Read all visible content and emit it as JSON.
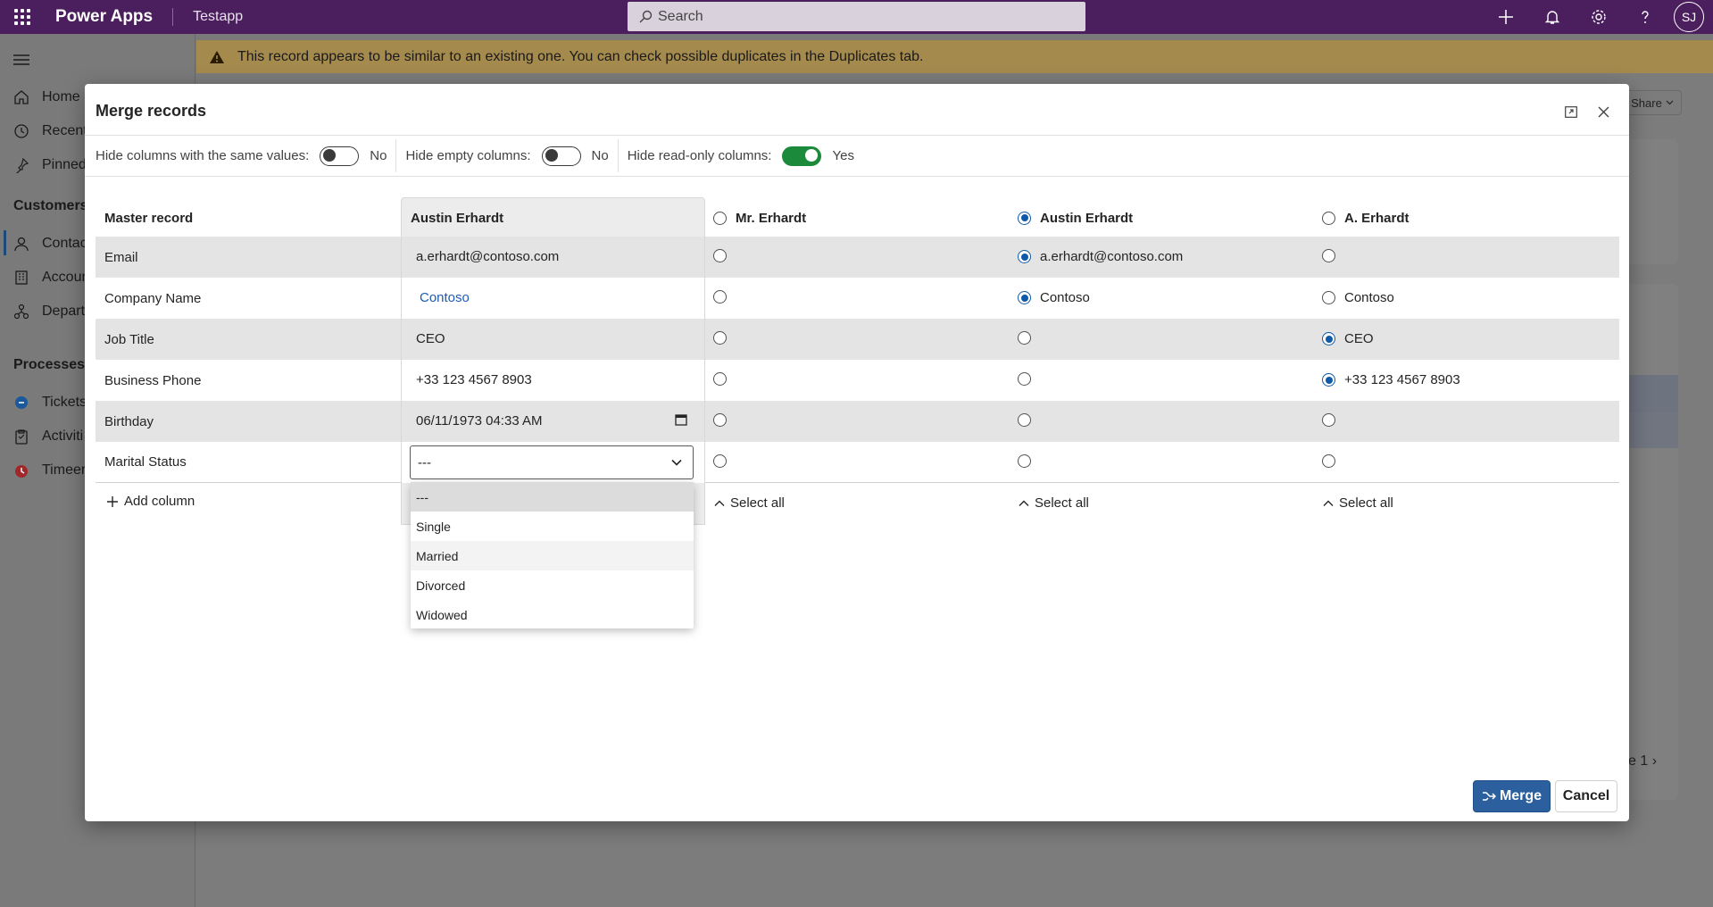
{
  "topbar": {
    "app_name": "Power Apps",
    "env_name": "Testapp",
    "search_placeholder": "Search",
    "avatar_initials": "SJ"
  },
  "nav": {
    "items": [
      {
        "label": "Home",
        "icon": "home-icon"
      },
      {
        "label": "Recent",
        "icon": "clock-icon"
      },
      {
        "label": "Pinned",
        "icon": "pin-icon"
      }
    ],
    "section_customers": "Customers",
    "customers_items": [
      {
        "label": "Contac",
        "icon": "person-icon"
      },
      {
        "label": "Accoun",
        "icon": "building-icon"
      },
      {
        "label": "Depart",
        "icon": "org-icon"
      }
    ],
    "section_processes": "Processes",
    "processes_items": [
      {
        "label": "Tickets",
        "icon": "ticket-icon"
      },
      {
        "label": "Activiti",
        "icon": "clipboard-icon"
      },
      {
        "label": "Timeer",
        "icon": "timer-icon"
      }
    ]
  },
  "banner": {
    "text": "This record appears to be similar to an existing one. You can check possible duplicates in the Duplicates tab."
  },
  "background": {
    "share_label": "Share",
    "page_label": "e 1"
  },
  "modal": {
    "title": "Merge records",
    "options": {
      "hide_same_label": "Hide columns with the same values:",
      "hide_same_value": "No",
      "hide_same_on": false,
      "hide_empty_label": "Hide empty columns:",
      "hide_empty_value": "No",
      "hide_empty_on": false,
      "hide_readonly_label": "Hide read-only columns:",
      "hide_readonly_value": "Yes",
      "hide_readonly_on": true
    },
    "header": {
      "label": "Master record",
      "master": "Austin Erhardt",
      "col_a": "Mr. Erhardt",
      "col_b": "Austin Erhardt",
      "col_c": "A. Erhardt",
      "selected_column": "col_b"
    },
    "rows": [
      {
        "label": "Email",
        "master": "a.erhardt@contoso.com",
        "a": "",
        "b": "a.erhardt@contoso.com",
        "c": "",
        "selected": "b"
      },
      {
        "label": "Company Name",
        "master": "Contoso",
        "a": "",
        "b": "Contoso",
        "c": "Contoso",
        "selected": "b"
      },
      {
        "label": "Job Title",
        "master": "CEO",
        "a": "",
        "b": "",
        "c": "CEO",
        "selected": "c"
      },
      {
        "label": "Business Phone",
        "master": "+33 123 4567 8903",
        "a": "",
        "b": "",
        "c": "+33 123 4567 8903",
        "selected": "c"
      },
      {
        "label": "Birthday",
        "master": "06/11/1973 04:33 AM",
        "a": "",
        "b": "",
        "c": "",
        "selected": ""
      },
      {
        "label": "Marital Status",
        "master": "---",
        "a": "",
        "b": "",
        "c": "",
        "selected": ""
      }
    ],
    "marital_options": [
      "---",
      "Single",
      "Married",
      "Divorced",
      "Widowed"
    ],
    "add_column_label": "Add column",
    "select_all_label": "Select all",
    "merge_label": "Merge",
    "cancel_label": "Cancel"
  },
  "colors": {
    "topbar": "#4b1e5e",
    "accent": "#0f5aa8",
    "toggle_on": "#1b8a3a",
    "merge_button": "#2b5f9e"
  }
}
